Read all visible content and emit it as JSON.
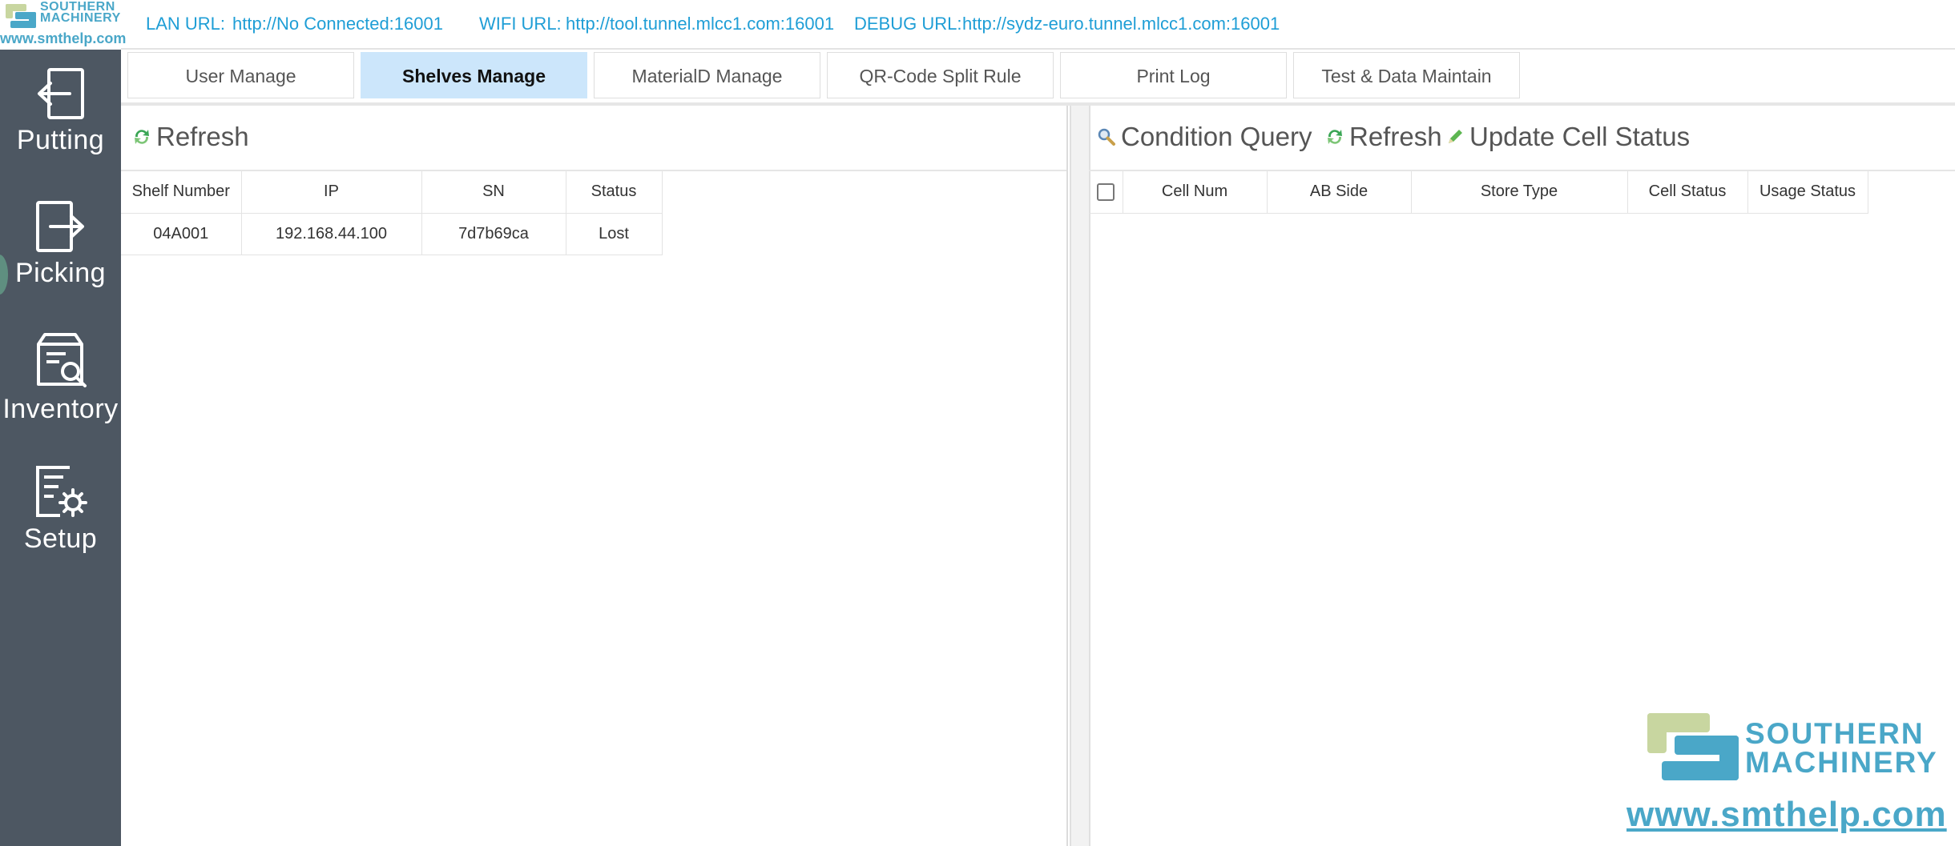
{
  "brand": {
    "name_line1": "SOUTHERN",
    "name_line2": "MACHINERY",
    "url": "www.smthelp.com"
  },
  "sidebar": {
    "items": [
      {
        "label": "Putting",
        "icon": "putting-icon"
      },
      {
        "label": "Picking",
        "icon": "picking-icon"
      },
      {
        "label": "Inventory",
        "icon": "inventory-icon"
      },
      {
        "label": "Setup",
        "icon": "setup-icon"
      }
    ]
  },
  "urlbar": {
    "lan_label": "LAN URL:",
    "lan_value": "http://No Connected:16001",
    "wifi_label": "WIFI URL:",
    "wifi_value": "http://tool.tunnel.mlcc1.com:16001",
    "debug_label": "DEBUG URL:",
    "debug_value": "http://sydz-euro.tunnel.mlcc1.com:16001"
  },
  "tabs": [
    {
      "label": "User Manage",
      "active": false
    },
    {
      "label": "Shelves Manage",
      "active": true
    },
    {
      "label": "MaterialD Manage",
      "active": false
    },
    {
      "label": "QR-Code Split Rule",
      "active": false
    },
    {
      "label": "Print Log",
      "active": false
    },
    {
      "label": "Test & Data Maintain",
      "active": false
    }
  ],
  "left_panel": {
    "refresh_label": "Refresh",
    "columns": [
      "Shelf Number",
      "IP",
      "SN",
      "Status"
    ],
    "rows": [
      [
        "04A001",
        "192.168.44.100",
        "7d7b69ca",
        "Lost"
      ]
    ]
  },
  "right_panel": {
    "query_label": "Condition Query",
    "refresh_label": "Refresh",
    "update_label": "Update Cell Status",
    "columns": [
      "Cell Num",
      "AB Side",
      "Store Type",
      "Cell Status",
      "Usage Status"
    ],
    "rows": []
  },
  "colors": {
    "sidebar_bg": "#4d5762",
    "accent": "#1f9ed6",
    "active_tab": "#cce6fb",
    "brand": "#4aa7c8",
    "brand_green": "#c8d6a0"
  }
}
